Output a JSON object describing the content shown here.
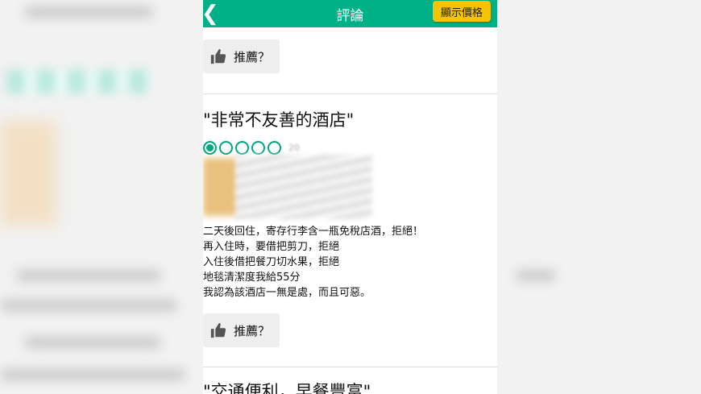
{
  "header": {
    "back_icon": "chevron-left-icon",
    "title": "評論",
    "price_button": "顯示價格"
  },
  "recommend_label": "推薦？",
  "review": {
    "title": "\"非常不友善的酒店\"",
    "rating_bubbles": 1,
    "rating_max": 5,
    "date": "20",
    "body_lines": [
      "二天後回住，寄存行李含一瓶免稅店酒，拒絕！",
      "再入住時，要借把剪刀，拒絕",
      "入住後借把餐刀切水果，拒絕",
      "地毯清潔度我給55分",
      "我認為該酒店一無是處，而且可惡。"
    ]
  },
  "next_review": {
    "title": "\"交通便利，早餐豐富\""
  },
  "colors": {
    "accent": "#00b087",
    "bubble": "#00a680",
    "price_button": "#f5c400"
  }
}
